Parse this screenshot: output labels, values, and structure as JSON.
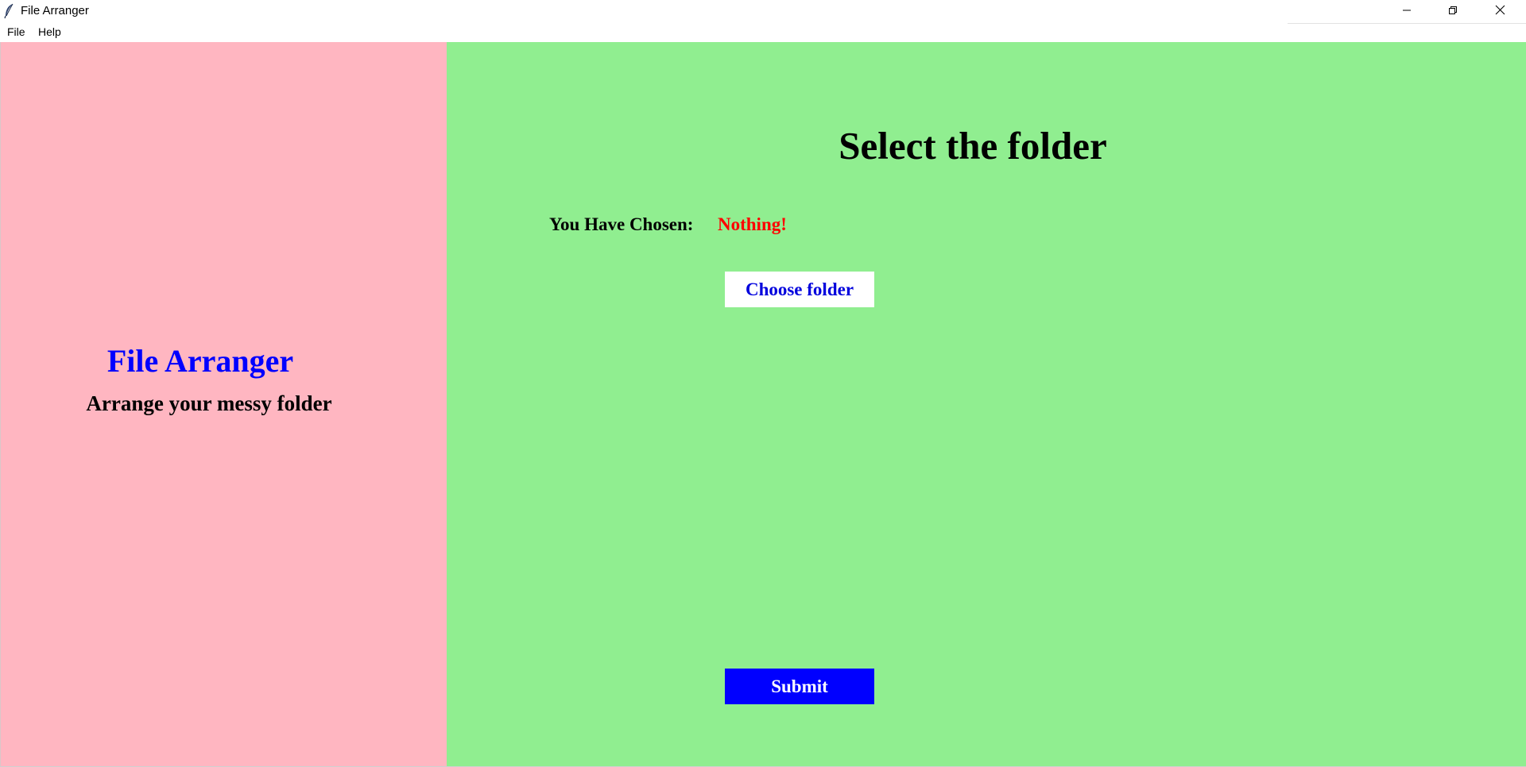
{
  "window": {
    "title": "File Arranger",
    "icon": "feather-icon",
    "controls": {
      "minimize_icon": "minimize-icon",
      "maximize_icon": "restore-icon",
      "close_icon": "close-icon"
    }
  },
  "menubar": {
    "items": [
      {
        "label": "File"
      },
      {
        "label": "Help"
      }
    ]
  },
  "left_panel": {
    "title": "File Arranger",
    "subtitle": "Arrange your messy folder",
    "background": "#ffb6c1",
    "title_color": "#0000ff"
  },
  "right_panel": {
    "heading": "Select the folder",
    "chosen_label": "You Have Chosen:",
    "chosen_value": "Nothing!",
    "chosen_value_color": "#ff0000",
    "choose_button_label": "Choose folder",
    "submit_button_label": "Submit",
    "background": "#90ee90",
    "submit_color": "#0000ff"
  }
}
